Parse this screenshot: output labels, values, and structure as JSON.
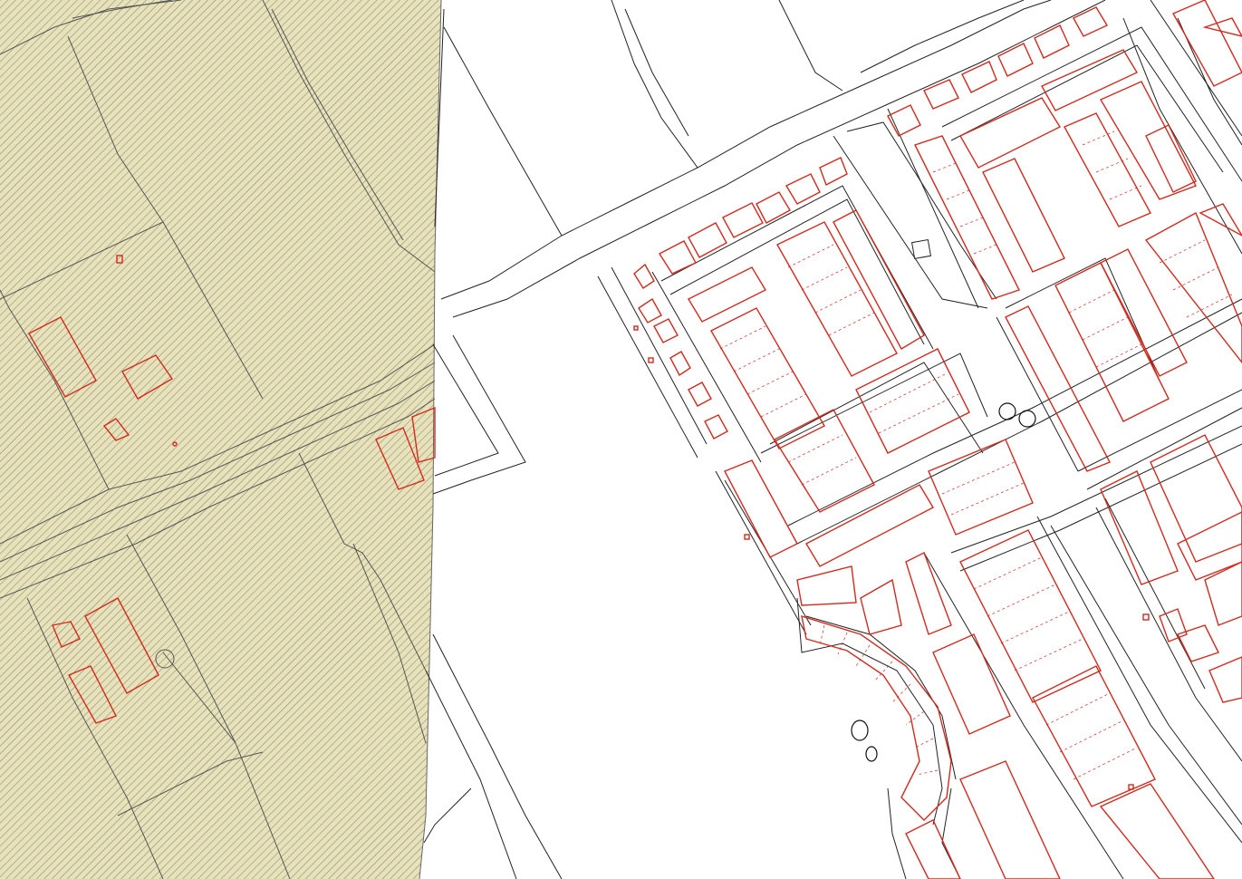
{
  "map": {
    "layers": [
      {
        "name": "zoning-area",
        "fill_color": "#e8e2b8",
        "hatch_color": "#8a8a8a"
      },
      {
        "name": "buildings",
        "stroke_color": "#d42a1e"
      },
      {
        "name": "parcels",
        "stroke_color": "#222222"
      }
    ]
  }
}
